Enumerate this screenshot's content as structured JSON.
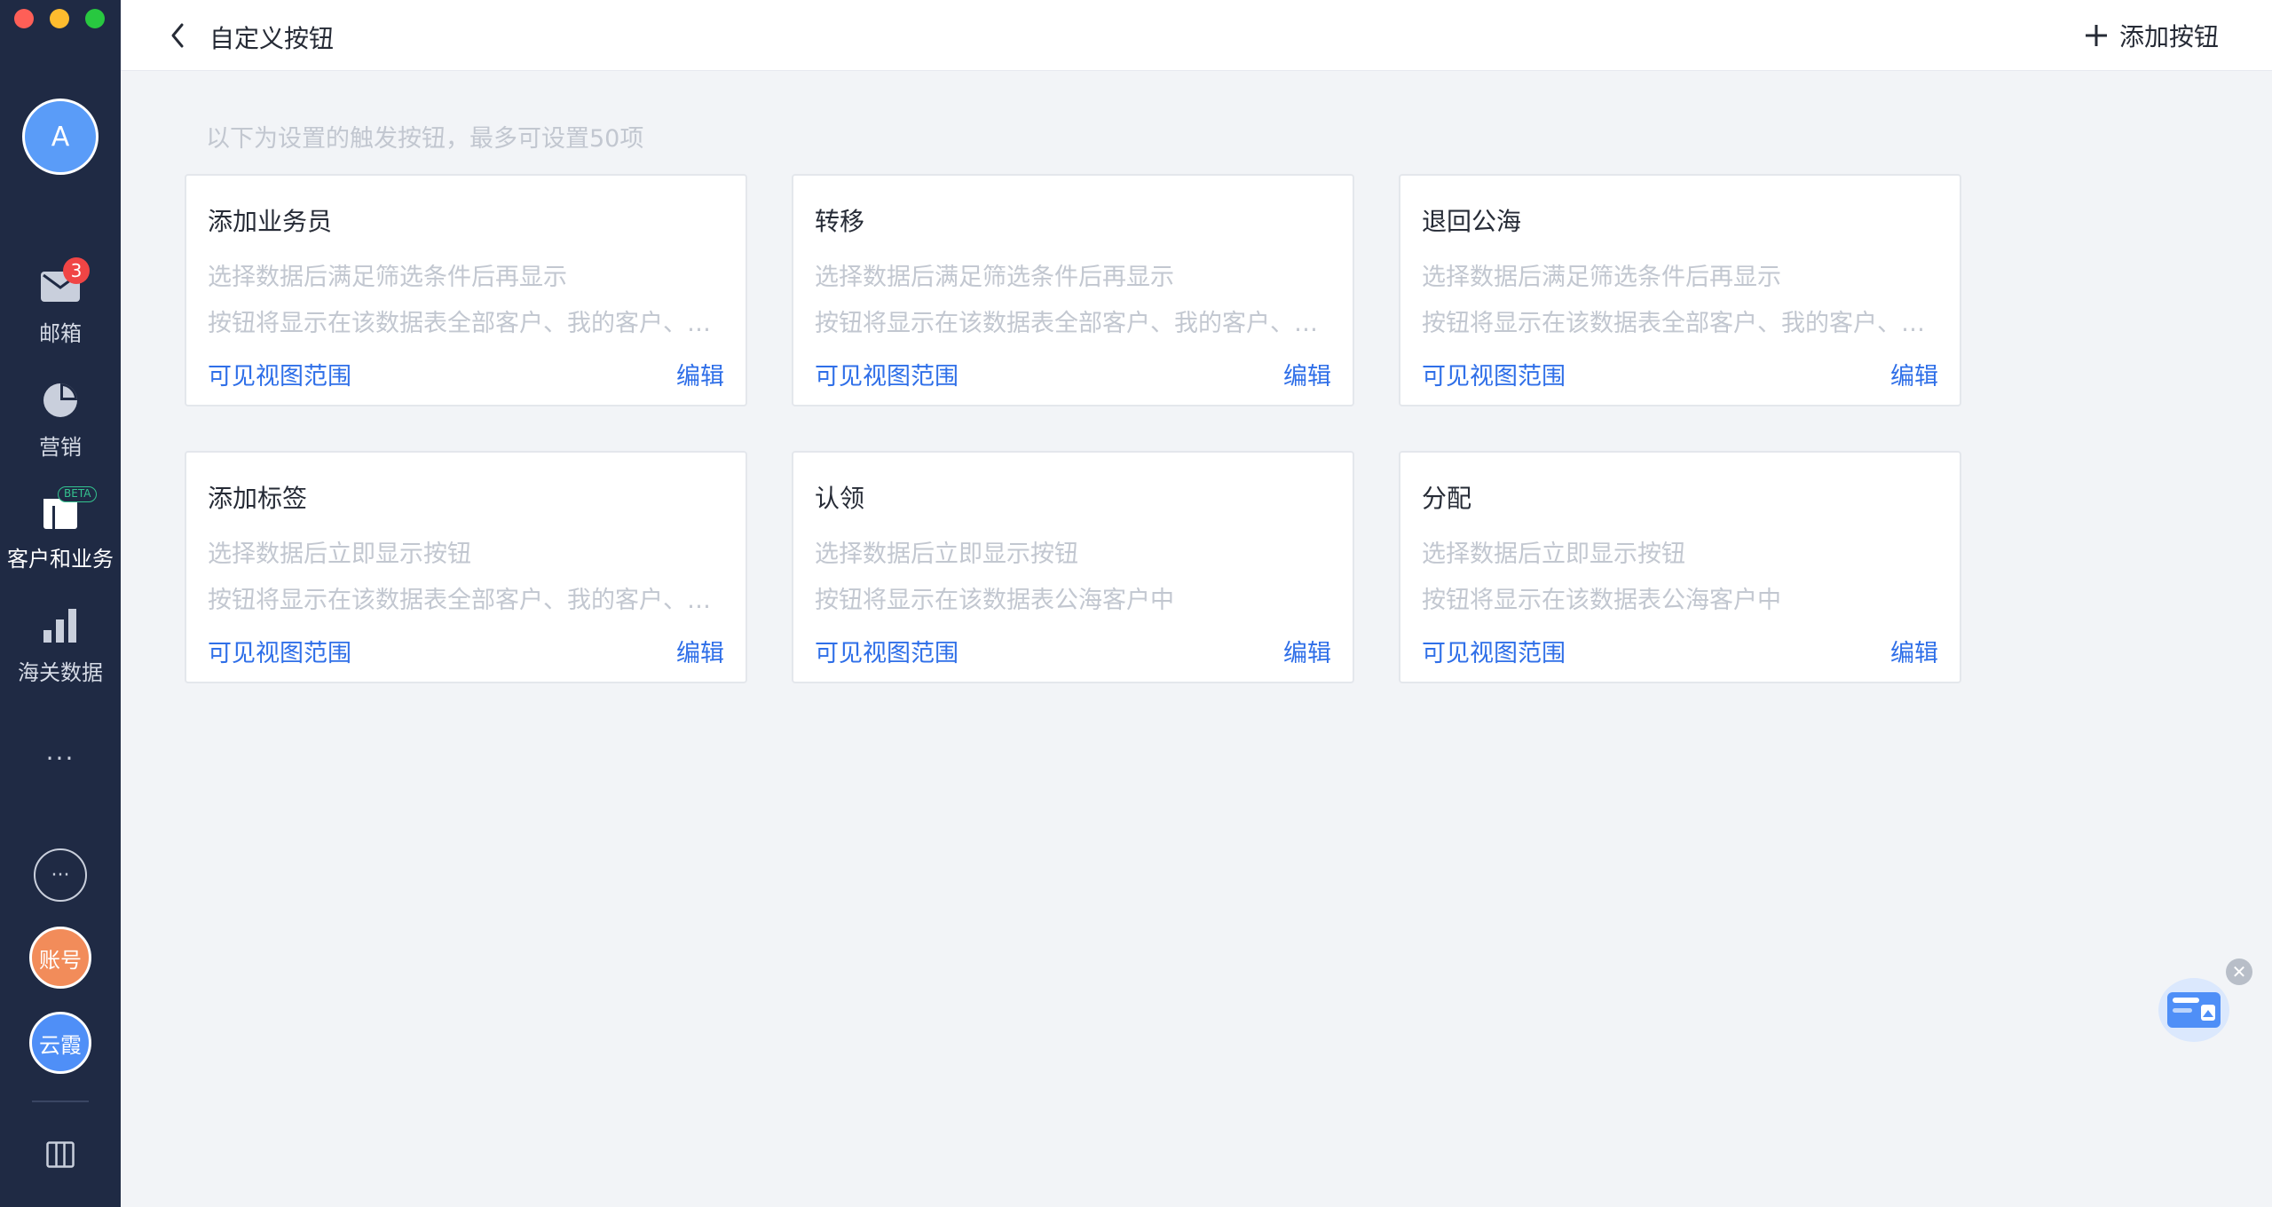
{
  "window": {
    "controls": [
      "close",
      "minimize",
      "zoom"
    ]
  },
  "sidebar": {
    "avatar_letter": "A",
    "items": [
      {
        "label": "邮箱",
        "icon": "mail-icon",
        "badge": "3"
      },
      {
        "label": "营销",
        "icon": "pie-chart-icon"
      },
      {
        "label": "客户和业务",
        "icon": "customer-icon",
        "tag": "BETA",
        "active": true
      },
      {
        "label": "海关数据",
        "icon": "bar-chart-icon"
      }
    ],
    "more_label": "···",
    "circle_more_label": "···",
    "account_avatar": "账号",
    "user_avatar": "云霞",
    "layout_icon": "layout-columns-icon"
  },
  "header": {
    "title": "自定义按钮",
    "add_label": "添加按钮"
  },
  "hint": "以下为设置的触发按钮，最多可设置50项",
  "cards": [
    {
      "title": "添加业务员",
      "line1": "选择数据后满足筛选条件后再显示",
      "line2": "按钮将显示在该数据表全部客户、我的客户、下属客户中",
      "scope": "可见视图范围",
      "edit": "编辑"
    },
    {
      "title": "转移",
      "line1": "选择数据后满足筛选条件后再显示",
      "line2": "按钮将显示在该数据表全部客户、我的客户、下属客户中",
      "scope": "可见视图范围",
      "edit": "编辑"
    },
    {
      "title": "退回公海",
      "line1": "选择数据后满足筛选条件后再显示",
      "line2": "按钮将显示在该数据表全部客户、我的客户、下属客户中",
      "scope": "可见视图范围",
      "edit": "编辑"
    },
    {
      "title": "添加标签",
      "line1": "选择数据后立即显示按钮",
      "line2": "按钮将显示在该数据表全部客户、我的客户、下属客户中",
      "scope": "可见视图范围",
      "edit": "编辑"
    },
    {
      "title": "认领",
      "line1": "选择数据后立即显示按钮",
      "line2": "按钮将显示在该数据表公海客户中",
      "scope": "可见视图范围",
      "edit": "编辑"
    },
    {
      "title": "分配",
      "line1": "选择数据后立即显示按钮",
      "line2": "按钮将显示在该数据表公海客户中",
      "scope": "可见视图范围",
      "edit": "编辑"
    }
  ],
  "colors": {
    "sidebar_bg": "#1f2a44",
    "accent_link": "#2f6fe8",
    "badge": "#f04545",
    "page_bg": "#f2f4f7"
  }
}
